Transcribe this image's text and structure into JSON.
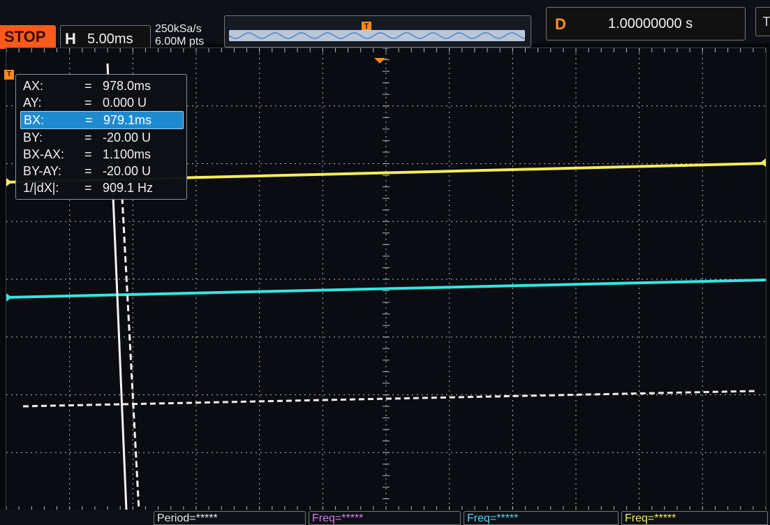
{
  "top": {
    "run_state": "STOP",
    "timebase_letter": "H",
    "timebase_value": "5.00ms",
    "sample_rate": "250kSa/s",
    "memory_depth": "6.00M pts",
    "mem_trigger_icon": "T",
    "delay_letter": "D",
    "delay_value": "1.00000000 s",
    "trigger_edge_icon": "T"
  },
  "channels": {
    "ch1_color": "#f4ec5a",
    "ch2_color": "#33e6e0",
    "grid_color": "#b9bcc4",
    "trigger_icon": "T"
  },
  "cursor": {
    "rows": [
      {
        "label": "AX:",
        "eq": "=",
        "value": "978.0ms"
      },
      {
        "label": "AY:",
        "eq": "=",
        "value": "0.000 U"
      },
      {
        "label": "BX:",
        "eq": "=",
        "value": "979.1ms"
      },
      {
        "label": "BY:",
        "eq": "=",
        "value": "-20.00 U"
      },
      {
        "label": "BX-AX:",
        "eq": "=",
        "value": "1.100ms"
      },
      {
        "label": "BY-AY:",
        "eq": "=",
        "value": "-20.00 U"
      },
      {
        "label": "1/|dX|:",
        "eq": "=",
        "value": "909.1 Hz"
      }
    ],
    "selected_index": 2
  },
  "measurements": [
    {
      "label": "Period=*****",
      "color": "#e8e8e8"
    },
    {
      "label": "Freq=*****",
      "color": "#d77cf0"
    },
    {
      "label": "Freq=*****",
      "color": "#4ed6f2"
    },
    {
      "label": "Freq=*****",
      "color": "#f4ec5a"
    }
  ]
}
